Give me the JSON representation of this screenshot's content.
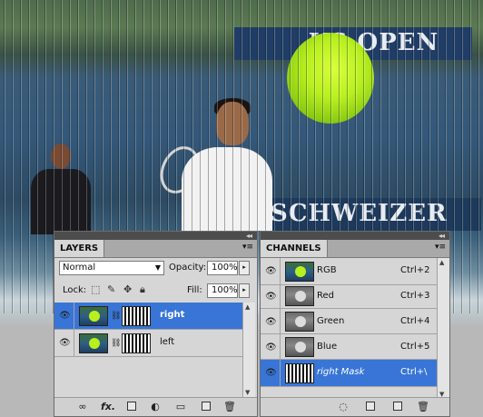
{
  "layers_panel": {
    "tab": "LAYERS",
    "blend_mode": "Normal",
    "opacity_label": "Opacity:",
    "opacity_value": "100%",
    "lock_label": "Lock:",
    "fill_label": "Fill:",
    "fill_value": "100%",
    "layers": [
      {
        "name": "right",
        "selected": true
      },
      {
        "name": "left",
        "selected": false
      }
    ],
    "footer_icons": [
      "link-layers-icon",
      "fx-icon",
      "add-mask-icon",
      "adjustment-layer-icon",
      "new-group-icon",
      "new-layer-icon",
      "trash-icon"
    ],
    "fx_label": "fx."
  },
  "channels_panel": {
    "tab": "CHANNELS",
    "channels": [
      {
        "name": "RGB",
        "shortcut": "Ctrl+2",
        "selected": false
      },
      {
        "name": "Red",
        "shortcut": "Ctrl+3",
        "selected": false
      },
      {
        "name": "Green",
        "shortcut": "Ctrl+4",
        "selected": false
      },
      {
        "name": "Blue",
        "shortcut": "Ctrl+5",
        "selected": false
      },
      {
        "name": "right Mask",
        "shortcut": "Ctrl+\\",
        "selected": true
      }
    ],
    "footer_icons": [
      "load-selection-icon",
      "save-selection-icon",
      "new-channel-icon",
      "trash-icon"
    ]
  },
  "colors": {
    "selection": "#3875d7",
    "panel_bg": "#d6d6d6",
    "panel_header": "#4d4d4d"
  }
}
